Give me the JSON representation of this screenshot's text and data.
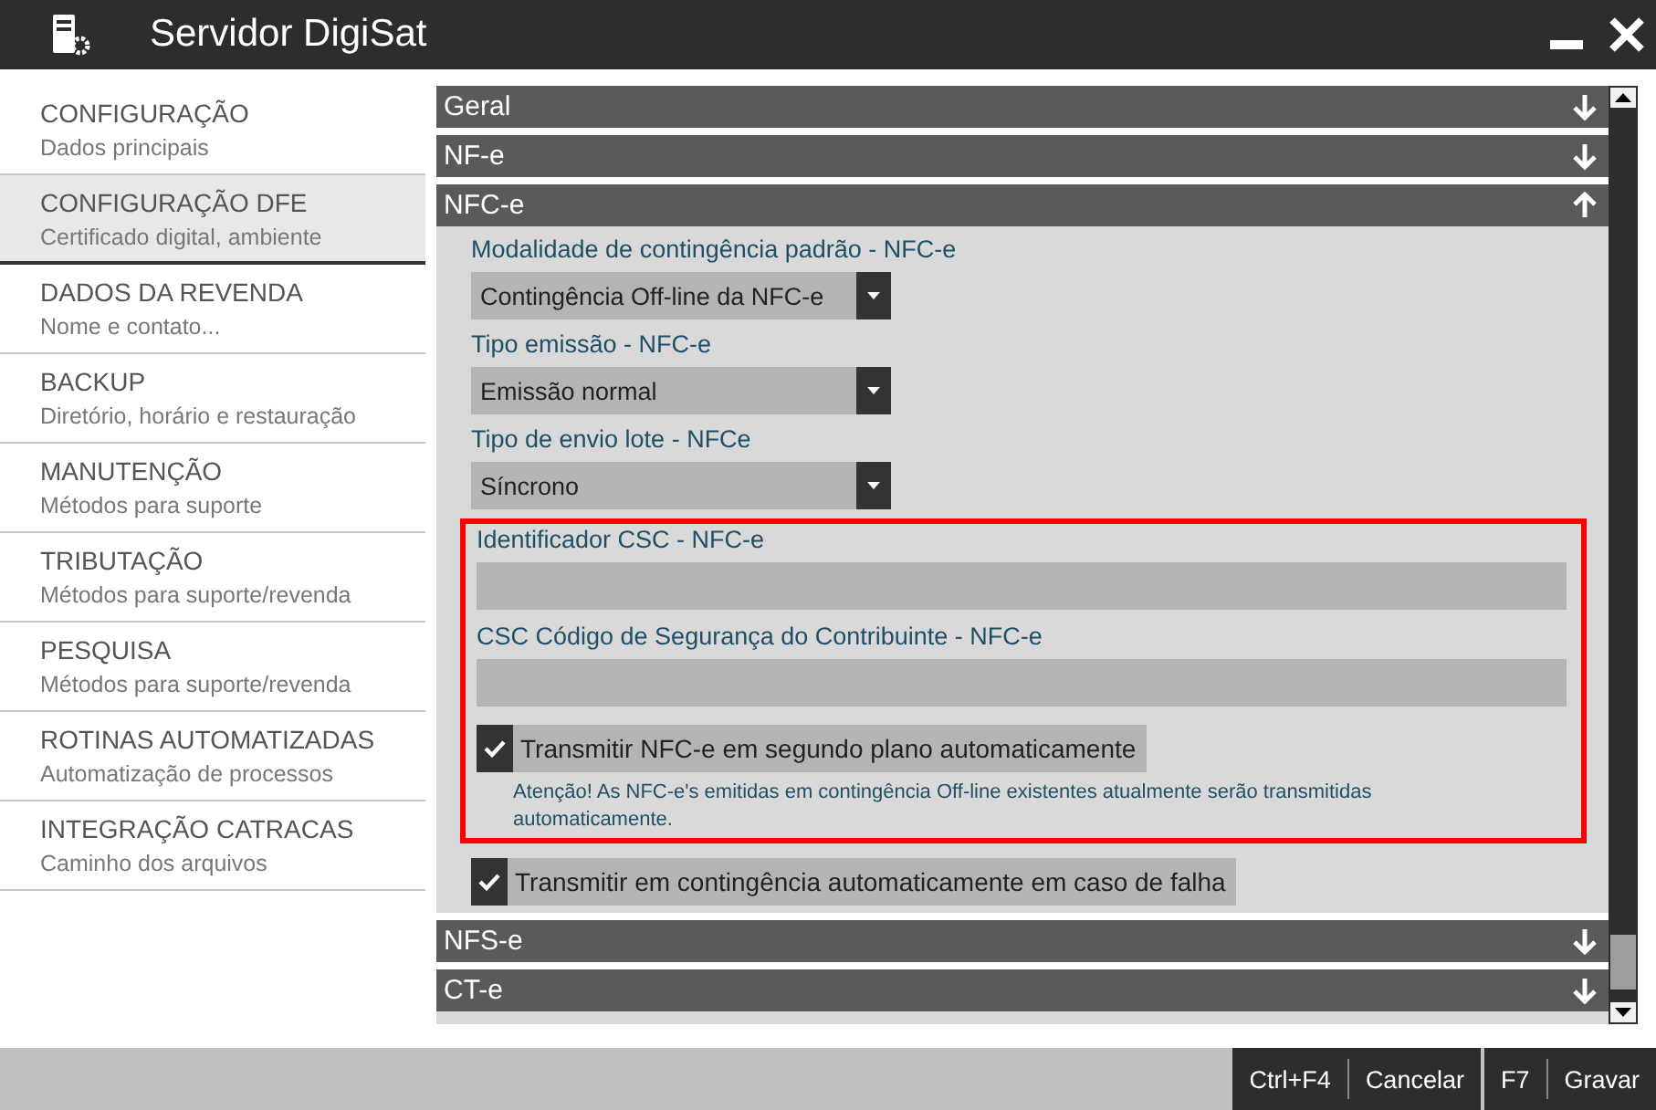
{
  "window": {
    "title": "Servidor DigiSat"
  },
  "sidebar": {
    "items": [
      {
        "title": "CONFIGURAÇÃO",
        "subtitle": "Dados principais",
        "selected": false
      },
      {
        "title": "CONFIGURAÇÃO DFE",
        "subtitle": "Certificado digital, ambiente",
        "selected": true
      },
      {
        "title": "DADOS DA REVENDA",
        "subtitle": "Nome e contato...",
        "selected": false
      },
      {
        "title": "BACKUP",
        "subtitle": "Diretório, horário e restauração",
        "selected": false
      },
      {
        "title": "MANUTENÇÃO",
        "subtitle": "Métodos para suporte",
        "selected": false
      },
      {
        "title": "TRIBUTAÇÃO",
        "subtitle": "Métodos para suporte/revenda",
        "selected": false
      },
      {
        "title": "PESQUISA",
        "subtitle": "Métodos para suporte/revenda",
        "selected": false
      },
      {
        "title": "ROTINAS AUTOMATIZADAS",
        "subtitle": "Automatização de processos",
        "selected": false
      },
      {
        "title": "INTEGRAÇÃO CATRACAS",
        "subtitle": "Caminho dos arquivos",
        "selected": false
      }
    ]
  },
  "sections": [
    {
      "title": "Geral",
      "expanded": false
    },
    {
      "title": "NF-e",
      "expanded": false
    },
    {
      "title": "NFC-e",
      "expanded": true,
      "fields": [
        {
          "kind": "select",
          "label": "Modalidade de contingência padrão - NFC-e",
          "value": "Contingência Off-line da NFC-e"
        },
        {
          "kind": "select",
          "label": "Tipo emissão - NFC-e",
          "value": "Emissão normal"
        },
        {
          "kind": "select",
          "label": "Tipo de envio lote - NFCe",
          "value": "Síncrono"
        },
        {
          "kind": "group",
          "highlighted": true,
          "fields": [
            {
              "kind": "text",
              "label": "Identificador CSC - NFC-e"
            },
            {
              "kind": "text",
              "label": "CSC Código de Segurança do Contribuinte - NFC-e"
            },
            {
              "kind": "checkbox",
              "label": "Transmitir NFC-e em segundo plano automaticamente",
              "checked": true,
              "note": "Atenção! As NFC-e's emitidas em contingência Off-line existentes atualmente serão transmitidas automaticamente."
            }
          ]
        },
        {
          "kind": "checkbox",
          "label": "Transmitir em contingência automaticamente em caso de falha",
          "checked": true
        }
      ]
    },
    {
      "title": "NFS-e",
      "expanded": false
    },
    {
      "title": "CT-e",
      "expanded": false
    }
  ],
  "footer": {
    "buttons": [
      {
        "key": "Ctrl+F4",
        "label": "Cancelar"
      },
      {
        "key": "F7",
        "label": "Gravar"
      }
    ]
  }
}
